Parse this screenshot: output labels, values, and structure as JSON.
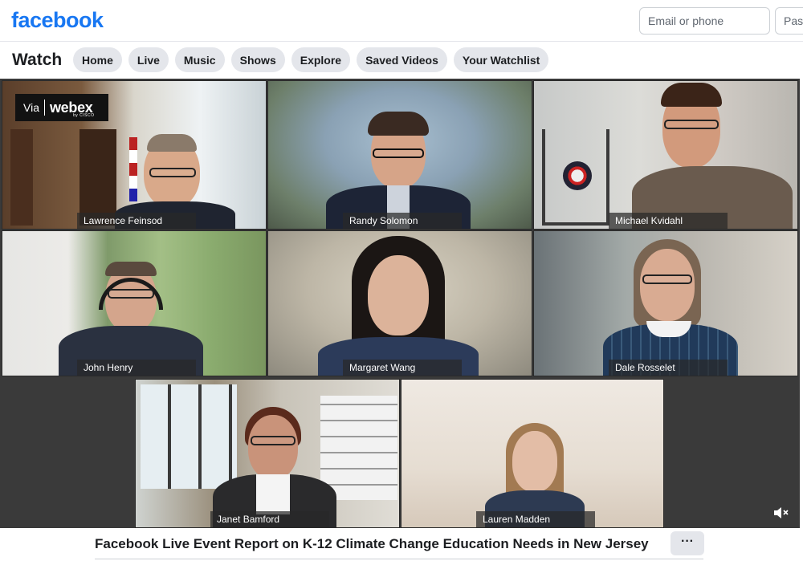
{
  "header": {
    "logo": "facebook",
    "email_placeholder": "Email or phone",
    "password_placeholder": "Pass"
  },
  "watch": {
    "title": "Watch",
    "tabs": [
      {
        "label": "Home"
      },
      {
        "label": "Live"
      },
      {
        "label": "Music"
      },
      {
        "label": "Shows"
      },
      {
        "label": "Explore"
      },
      {
        "label": "Saved Videos"
      },
      {
        "label": "Your Watchlist"
      }
    ]
  },
  "video": {
    "webex_badge": {
      "via": "Via",
      "brand": "webex",
      "sub": "by CISCO"
    },
    "participants": [
      {
        "name": "Lawrence Feinsod"
      },
      {
        "name": "Randy Solomon"
      },
      {
        "name": "Michael Kvidahl"
      },
      {
        "name": "John Henry"
      },
      {
        "name": "Margaret Wang"
      },
      {
        "name": "Dale Rosselet"
      },
      {
        "name": "Janet Bamford"
      },
      {
        "name": "Lauren Madden"
      }
    ]
  },
  "post": {
    "title": "Facebook Live Event Report on K-12 Climate Change Education Needs in New Jersey",
    "more_label": "···"
  }
}
